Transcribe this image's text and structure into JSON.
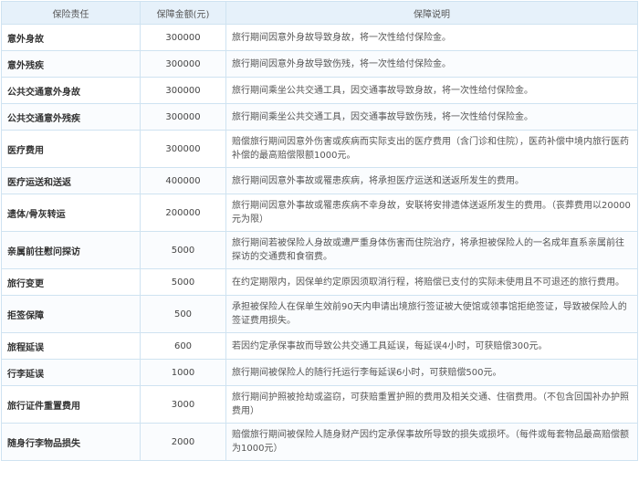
{
  "table": {
    "headers": [
      "保险责任",
      "保障金额(元)",
      "保障说明"
    ],
    "rows": [
      {
        "name": "意外身故",
        "amount": "300000",
        "desc": "旅行期间因意外身故导致身故，将一次性给付保险金。"
      },
      {
        "name": "意外残疾",
        "amount": "300000",
        "desc": "旅行期间因意外身故导致伤残，将一次性给付保险金。"
      },
      {
        "name": "公共交通意外身故",
        "amount": "300000",
        "desc": "旅行期间乘坐公共交通工具，因交通事故导致身故，将一次性给付保险金。"
      },
      {
        "name": "公共交通意外残疾",
        "amount": "300000",
        "desc": "旅行期间乘坐公共交通工具，因交通事故导致伤残，将一次性给付保险金。"
      },
      {
        "name": "医疗费用",
        "amount": "300000",
        "desc": "赔偿旅行期间因意外伤害或疾病而实际支出的医疗费用（含门诊和住院），医药补偿中境内旅行医药补偿的最高赔偿限额1000元。"
      },
      {
        "name": "医疗运送和送返",
        "amount": "400000",
        "desc": "旅行期间因意外事故或罹患疾病，将承担医疗运送和送返所发生的费用。"
      },
      {
        "name": "遗体/骨灰转运",
        "amount": "200000",
        "desc": "旅行期间因意外事故或罹患疾病不幸身故，安联将安排遗体送返所发生的费用。（丧葬费用以20000元为限）"
      },
      {
        "name": "亲属前往慰问探访",
        "amount": "5000",
        "desc": "旅行期间若被保险人身故或遭严重身体伤害而住院治疗，将承担被保险人的一名成年直系亲属前往探访的交通费和食宿费。"
      },
      {
        "name": "旅行变更",
        "amount": "5000",
        "desc": "在约定期限内，因保单约定原因须取消行程，将赔偿已支付的实际未使用且不可退还的旅行费用。"
      },
      {
        "name": "拒签保障",
        "amount": "500",
        "desc": "承担被保险人在保单生效前90天内申请出境旅行签证被大使馆或领事馆拒绝签证，导致被保险人的签证费用损失。"
      },
      {
        "name": "旅程延误",
        "amount": "600",
        "desc": "若因约定承保事故而导致公共交通工具延误，每延误4小时，可获赔偿300元。"
      },
      {
        "name": "行李延误",
        "amount": "1000",
        "desc": "旅行期间被保险人的随行托运行李每延误6小时，可获赔偿500元。"
      },
      {
        "name": "旅行证件重置费用",
        "amount": "3000",
        "desc": "旅行期间护照被抢劫或盗窃，可获赔重置护照的费用及相关交通、住宿费用。（不包含回国补办护照费用）"
      },
      {
        "name": "随身行李物品损失",
        "amount": "2000",
        "desc": "赔偿旅行期间被保险人随身财产因约定承保事故所导致的损失或损坏。（每件或每套物品最高赔偿额为1000元）"
      }
    ]
  }
}
